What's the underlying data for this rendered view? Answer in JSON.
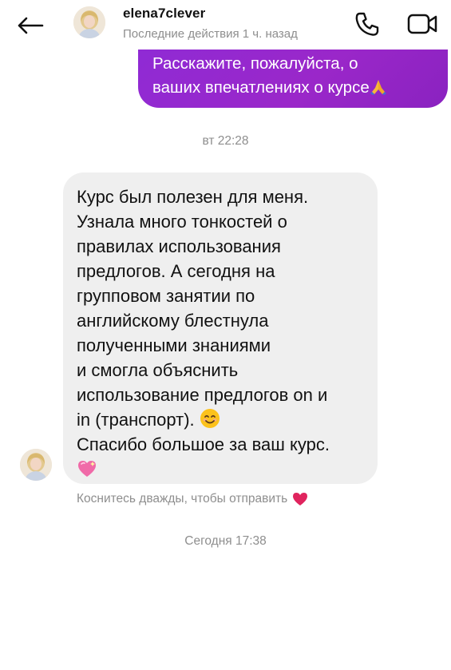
{
  "header": {
    "username": "elena7clever",
    "status": "Последние действия 1 ч. назад",
    "back_icon": "arrow-left-icon",
    "call_icon": "phone-icon",
    "video_icon": "video-camera-icon"
  },
  "outgoing_message": {
    "lines": [
      "Расскажите, пожалуйста,  о",
      "ваших впечатлениях о курсе"
    ],
    "emoji": "folded-hands-emoji",
    "color": "#8e2bd6"
  },
  "timestamps": [
    "вт 22:28",
    "Сегодня 17:38"
  ],
  "incoming_message": {
    "lines": [
      "Курс был полезен для меня.",
      "Узнала много тонкостей о",
      "правилах использования",
      "предлогов. А сегодня на",
      "групповом занятии по",
      "английскому блестнула",
      "полученными знаниями",
      "и смогла объяснить",
      "использование предлогов on и",
      "in (транспорт).",
      "Спасибо большое за ваш курс."
    ],
    "emojis": [
      "smiling-face-emoji",
      "sparkling-heart-emoji"
    ],
    "background": "#efefef"
  },
  "double_tap_hint": {
    "text": "Коснитесь дважды, чтобы отправить",
    "icon": "red-heart-icon",
    "color": "#e0245e"
  }
}
